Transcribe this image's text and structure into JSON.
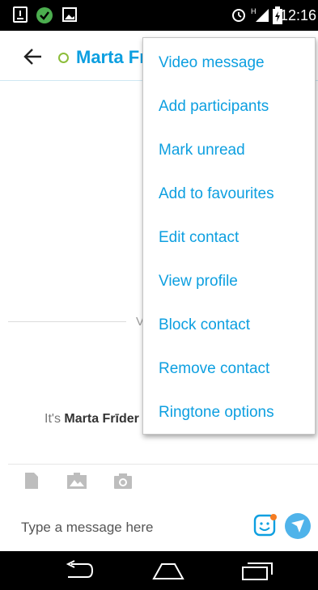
{
  "status_bar": {
    "time": "12:16",
    "icons": [
      "download-notification-icon",
      "check-notification-icon",
      "image-notification-icon",
      "alarm-icon",
      "signal-icon",
      "battery-icon"
    ]
  },
  "header": {
    "contact_name": "Marta Frīderika",
    "presence": "online-ring"
  },
  "chat": {
    "date_fragment": "V",
    "intro_prefix": "It's",
    "intro_name": "Marta Frīder"
  },
  "compose": {
    "placeholder": "Type a message here",
    "attach_icons": [
      "file-icon",
      "photo-icon",
      "camera-icon"
    ]
  },
  "menu": {
    "items": [
      "Video message",
      "Add participants",
      "Mark unread",
      "Add to favourites",
      "Edit contact",
      "View profile",
      "Block contact",
      "Remove contact",
      "Ringtone options"
    ]
  },
  "colors": {
    "accent": "#0d9fe0",
    "send": "#4fb3ea",
    "presence": "#8cbd3a",
    "emoji_badge": "#f57c22"
  }
}
